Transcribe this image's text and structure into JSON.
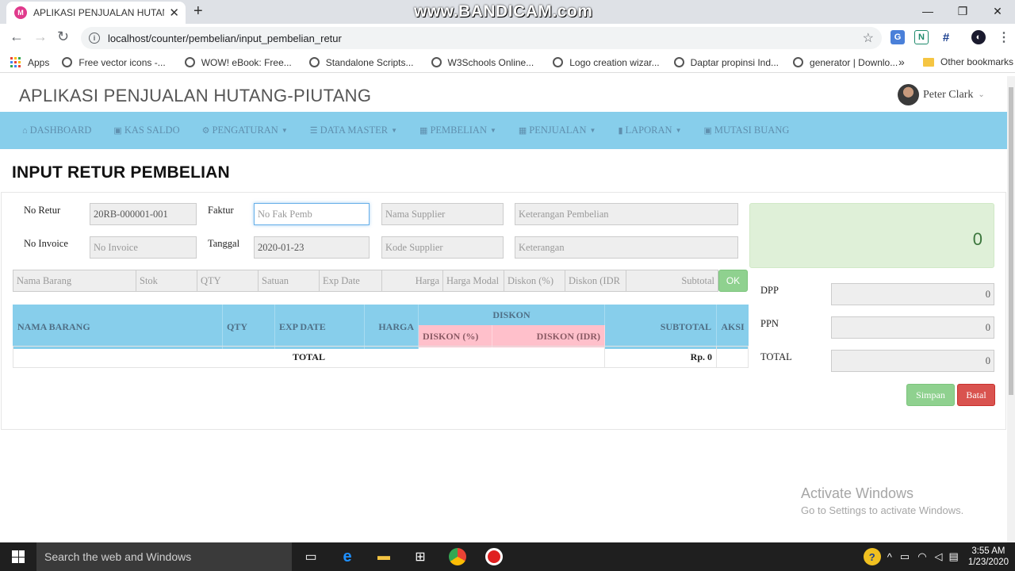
{
  "browser": {
    "tab_title": "APLIKASI PENJUALAN HUTANG-PIUTANG",
    "tab_favicon_text": "M",
    "watermark": "www.BANDICAM.com",
    "url": "localhost/counter/pembelian/input_pembelian_retur",
    "bookmarks": [
      {
        "label": "Apps"
      },
      {
        "label": "Free vector icons -..."
      },
      {
        "label": "WOW! eBook: Free..."
      },
      {
        "label": "Standalone Scripts..."
      },
      {
        "label": "W3Schools Online..."
      },
      {
        "label": "Logo creation wizar..."
      },
      {
        "label": "Daptar propinsi Ind..."
      },
      {
        "label": "generator | Downlo..."
      }
    ],
    "other_bookmarks": "Other bookmarks"
  },
  "app": {
    "title": "APLIKASI PENJUALAN HUTANG-PIUTANG",
    "user_name": "Peter Clark",
    "nav": [
      {
        "label": "DASHBOARD",
        "icon": "home-icon",
        "dropdown": false
      },
      {
        "label": "KAS SALDO",
        "icon": "money-icon",
        "dropdown": false
      },
      {
        "label": "PENGATURAN",
        "icon": "gear-icon",
        "dropdown": true
      },
      {
        "label": "DATA MASTER",
        "icon": "list-icon",
        "dropdown": true
      },
      {
        "label": "PEMBELIAN",
        "icon": "table-icon",
        "dropdown": true
      },
      {
        "label": "PENJUALAN",
        "icon": "table-icon",
        "dropdown": true
      },
      {
        "label": "LAPORAN",
        "icon": "book-icon",
        "dropdown": true
      },
      {
        "label": "MUTASI BUANG",
        "icon": "money-icon",
        "dropdown": false
      }
    ]
  },
  "page": {
    "title": "INPUT RETUR PEMBELIAN",
    "form": {
      "no_retur_label": "No Retur",
      "no_retur_value": "20RB-000001-001",
      "faktur_label": "Faktur",
      "faktur_placeholder": "No Fak Pemb",
      "nama_supplier_placeholder": "Nama Supplier",
      "keterangan_pembelian_placeholder": "Keterangan Pembelian",
      "no_invoice_label": "No Invoice",
      "no_invoice_placeholder": "No Invoice",
      "tanggal_label": "Tanggal",
      "tanggal_value": "2020-01-23",
      "kode_supplier_placeholder": "Kode Supplier",
      "keterangan_placeholder": "Keterangan"
    },
    "item_row": {
      "nama_barang": "Nama Barang",
      "stok": "Stok",
      "qty": "QTY",
      "satuan": "Satuan",
      "exp_date": "Exp Date",
      "harga": "Harga",
      "harga_modal": "Harga Modal",
      "diskon_pct": "Diskon (%)",
      "diskon_idr": "Diskon (IDR",
      "subtotal": "Subtotal",
      "ok_label": "OK"
    },
    "table": {
      "headers": {
        "nama_barang": "NAMA BARANG",
        "qty": "QTY",
        "exp_date": "EXP DATE",
        "harga": "HARGA",
        "diskon": "DISKON",
        "diskon_pct": "DISKON (%)",
        "diskon_idr": "DISKON (IDR)",
        "subtotal": "SUBTOTAL",
        "aksi": "AKSI"
      },
      "total_label": "TOTAL",
      "total_value": "Rp. 0"
    },
    "summary": {
      "grand_total": "0",
      "dpp_label": "DPP",
      "dpp_value": "0",
      "ppn_label": "PPN",
      "ppn_value": "0",
      "total_label": "TOTAL",
      "total_value": "0"
    },
    "buttons": {
      "save": "Simpan",
      "cancel": "Batal"
    }
  },
  "os": {
    "activate_title": "Activate Windows",
    "activate_sub": "Go to Settings to activate Windows.",
    "search_placeholder": "Search the web and Windows",
    "time": "3:55 AM",
    "date": "1/23/2020"
  },
  "colors": {
    "navbar": "#87ceeb",
    "nav_text": "#5f8fae",
    "table_header": "#87ceeb",
    "diskon_header": "#ffc0cb",
    "success": "#8fd18f",
    "danger": "#d9534f",
    "total_box": "#dff0d8"
  }
}
